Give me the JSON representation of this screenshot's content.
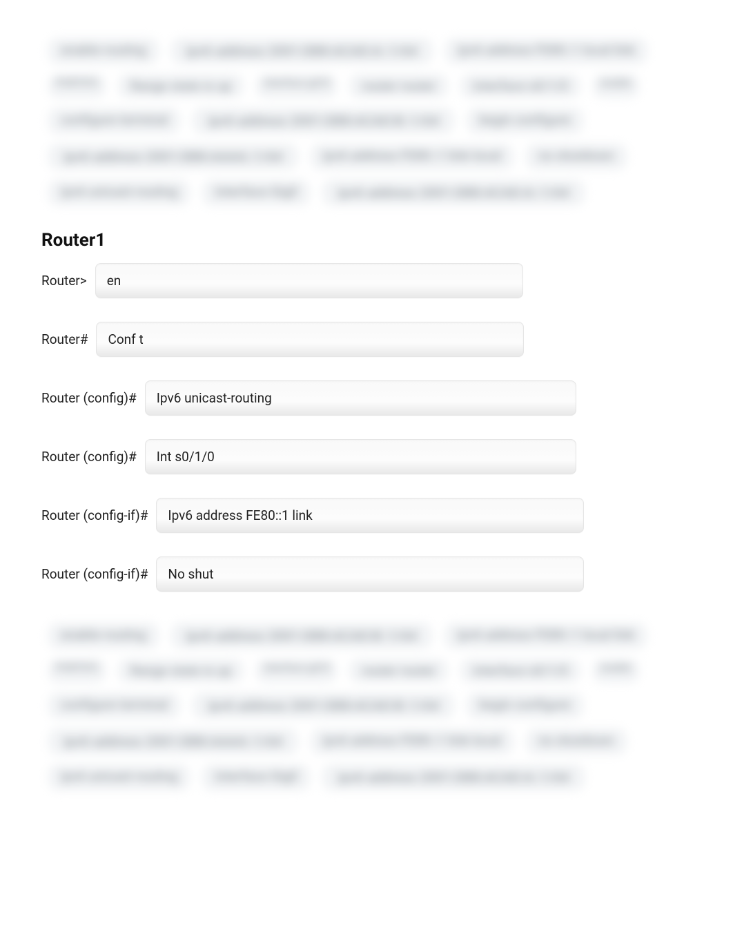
{
  "tag_cloud_top": [
    {
      "label": "enable-routing",
      "size": "m"
    },
    {
      "label": "ipv6 address 2001:DB8:ACAD:A::1/64",
      "size": "l"
    },
    {
      "label": "ipv6 address FE80::1 local link",
      "size": "m"
    },
    {
      "label": "PORTIFO",
      "size": "s"
    },
    {
      "label": "Range state is up",
      "size": "m"
    },
    {
      "label": "interface g0/0",
      "size": "s"
    },
    {
      "label": "router router",
      "size": "m"
    },
    {
      "label": "interface s0/1/0",
      "size": "m"
    },
    {
      "label": "enable",
      "size": "s"
    },
    {
      "label": "configure terminal",
      "size": "m"
    },
    {
      "label": "ipv6 address 2001:DB8:ACAD:B::1/64",
      "size": "l"
    },
    {
      "label": "begin configure",
      "size": "m"
    },
    {
      "label": "ipv6 address 2001:DB8:AAAA::1/64",
      "size": "l"
    },
    {
      "label": "ipv6 address FE80::1 link-local",
      "size": "m"
    },
    {
      "label": "no shutdown",
      "size": "m"
    },
    {
      "label": "ipv6 unicast-routing",
      "size": "m"
    },
    {
      "label": "interface Gig0",
      "size": "m"
    },
    {
      "label": "ipv6 address 2001:DB8:ACAD:A::1/64",
      "size": "l"
    }
  ],
  "heading": "Router1",
  "rows": [
    {
      "prompt": "Router>",
      "value": "en",
      "w": "w1"
    },
    {
      "prompt": "Router#",
      "value": "Conf t",
      "w": "w2"
    },
    {
      "prompt": "Router (config)#",
      "value": "Ipv6 unicast-routing",
      "w": "w3"
    },
    {
      "prompt": "Router (config)#",
      "value": "Int s0/1/0",
      "w": "w4"
    },
    {
      "prompt": "Router (config-if)#",
      "value": "Ipv6 address FE80::1 link",
      "w": "w5"
    },
    {
      "prompt": "Router (config-if)#",
      "value": "No shut",
      "w": "w6"
    }
  ],
  "tag_cloud_bottom": [
    {
      "label": "enable-routing",
      "size": "m"
    },
    {
      "label": "ipv6 address 2001:DB8:ACAD:B::1/64",
      "size": "l"
    },
    {
      "label": "ipv6 address FE80::1 local link",
      "size": "m"
    },
    {
      "label": "PORTIFO",
      "size": "s"
    },
    {
      "label": "Range state is up",
      "size": "m"
    },
    {
      "label": "interface g0/0",
      "size": "s"
    },
    {
      "label": "router router",
      "size": "m"
    },
    {
      "label": "interface s0/1/0",
      "size": "m"
    },
    {
      "label": "enable",
      "size": "s"
    },
    {
      "label": "configure terminal",
      "size": "m"
    },
    {
      "label": "ipv6 address 2001:DB8:ACAD:B::1/64",
      "size": "l"
    },
    {
      "label": "begin configure",
      "size": "m"
    },
    {
      "label": "ipv6 address 2001:DB8:AAAA::1/64",
      "size": "l"
    },
    {
      "label": "ipv6 address FE80::1 link-local",
      "size": "m"
    },
    {
      "label": "no shutdown",
      "size": "m"
    },
    {
      "label": "ipv6 unicast-routing",
      "size": "m"
    },
    {
      "label": "interface Gig0",
      "size": "m"
    },
    {
      "label": "ipv6 address 2001:DB8:ACAD:A::1/64",
      "size": "l"
    }
  ]
}
